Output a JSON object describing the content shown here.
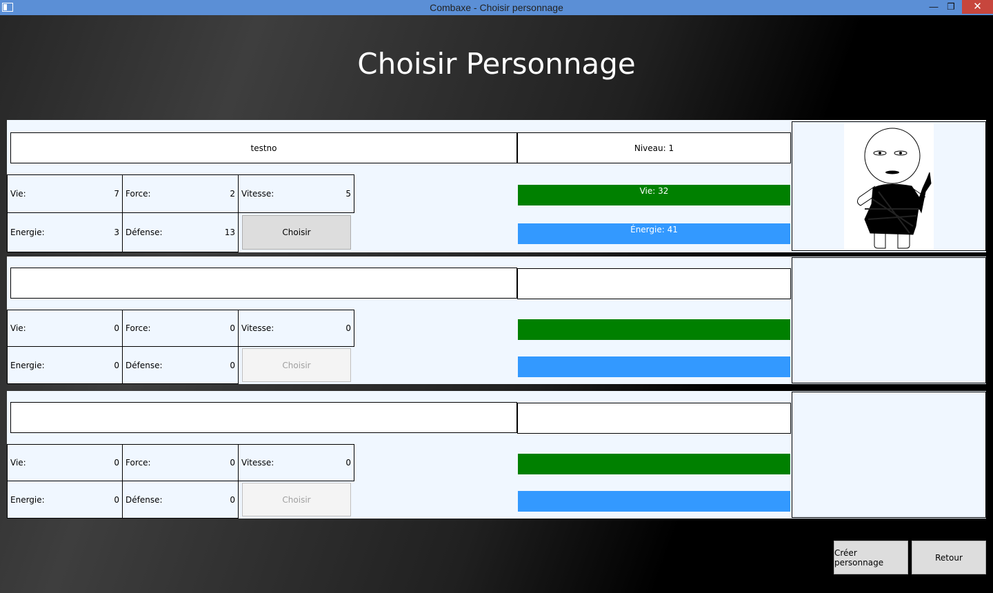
{
  "window": {
    "title": "Combaxe - Choisir personnage",
    "minimize": "—",
    "maximize": "❐",
    "close": "✕"
  },
  "page": {
    "title": "Choisir Personnage"
  },
  "labels": {
    "vie": "Vie:",
    "force": "Force:",
    "vitesse": "Vitesse:",
    "energie": "Energie:",
    "defense": "Défense:",
    "choose": "Choisir"
  },
  "characters": [
    {
      "name": "testno",
      "level": "Niveau: 1",
      "vie": "7",
      "force": "2",
      "vitesse": "5",
      "energie": "3",
      "defense": "13",
      "life_bar": "Vie: 32",
      "energy_bar": "Énergie: 41",
      "choose_enabled": true
    },
    {
      "name": "",
      "level": "",
      "vie": "0",
      "force": "0",
      "vitesse": "0",
      "energie": "0",
      "defense": "0",
      "life_bar": "",
      "energy_bar": "",
      "choose_enabled": false
    },
    {
      "name": "",
      "level": "",
      "vie": "0",
      "force": "0",
      "vitesse": "0",
      "energie": "0",
      "defense": "0",
      "life_bar": "",
      "energy_bar": "",
      "choose_enabled": false
    }
  ],
  "buttons": {
    "create": "Créer personnage",
    "back": "Retour"
  },
  "colors": {
    "titlebar": "#5b8fd6",
    "life_bar": "#008000",
    "energy_bar": "#3399ff",
    "card_bg": "#f0f7ff"
  }
}
